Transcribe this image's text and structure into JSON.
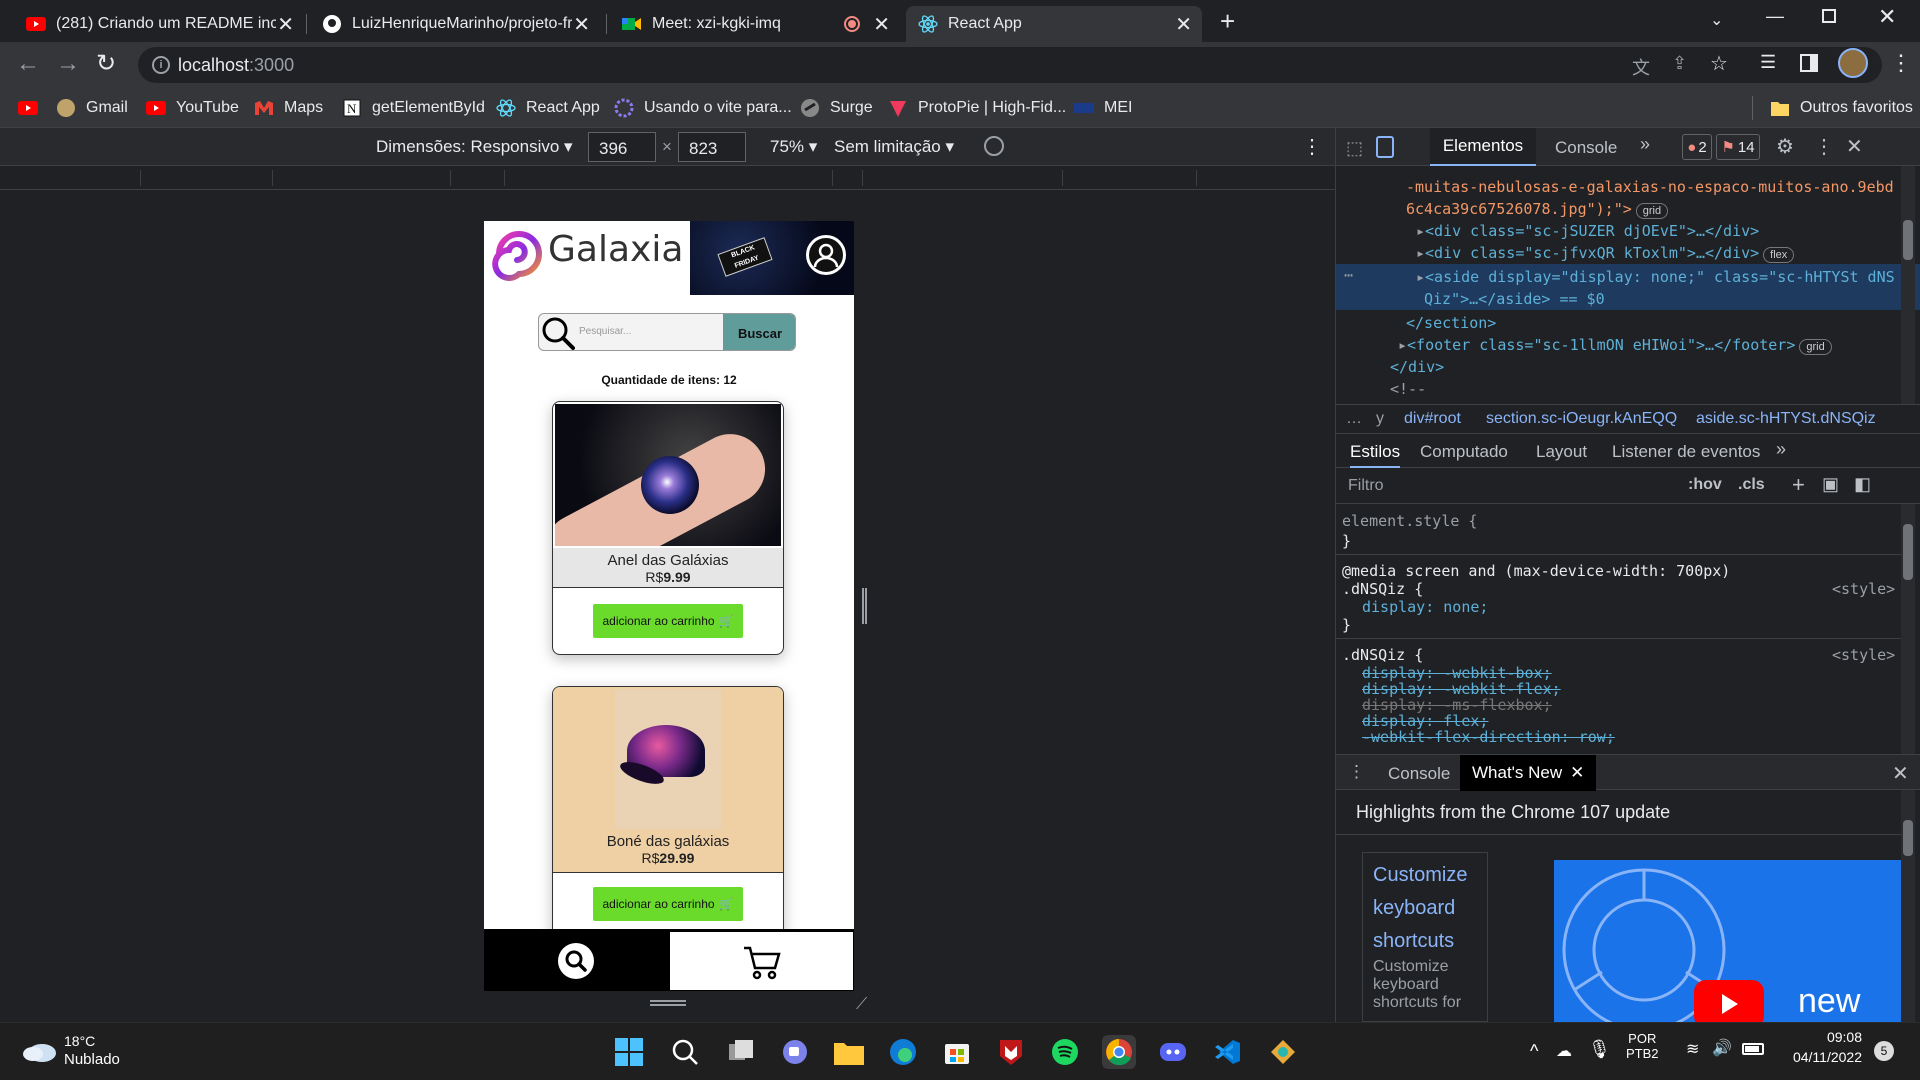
{
  "browser": {
    "tabs": [
      {
        "title": "(281) Criando um README incrív",
        "icon": "youtube-icon",
        "active": false
      },
      {
        "title": "LuizHenriqueMarinho/projeto-fro",
        "icon": "github-icon",
        "active": false
      },
      {
        "title": "Meet: xzi-kgki-imq",
        "icon": "meet-icon",
        "active": false
      },
      {
        "title": "React App",
        "icon": "react-icon",
        "active": true
      }
    ],
    "new_tab": "+",
    "url_host": "localhost",
    "url_port": ":3000",
    "bookmarks": [
      {
        "label": "",
        "icon": "youtube-icon"
      },
      {
        "label": "Gmail",
        "icon": "gmail-icon"
      },
      {
        "label": "YouTube",
        "icon": "youtube-icon"
      },
      {
        "label": "Maps",
        "icon": "maps-icon"
      },
      {
        "label": "getElementById",
        "icon": "notion-icon"
      },
      {
        "label": "React App",
        "icon": "react-icon"
      },
      {
        "label": "Usando o vite para...",
        "icon": "vite-icon"
      },
      {
        "label": "Surge",
        "icon": "surge-icon"
      },
      {
        "label": "ProtoPie | High-Fid...",
        "icon": "protopie-icon"
      },
      {
        "label": "MEI",
        "icon": "mei-icon"
      }
    ],
    "other_favorites": "Outros favoritos"
  },
  "device_toolbar": {
    "dimensions_label": "Dimensões: Responsivo",
    "width": "396",
    "times": "×",
    "height": "823",
    "zoom": "75%",
    "throttle": "Sem limitação"
  },
  "app": {
    "brand": "Galaxia",
    "banner_text": "BLACK FRIDAY",
    "search_placeholder": "Pesquisar...",
    "search_button": "Buscar",
    "quantity_label": "Quantidade de itens: 12",
    "products": [
      {
        "name": "Anel das Galáxias",
        "currency": "R$",
        "price": "9.99",
        "button": "adicionar ao carrinho"
      },
      {
        "name": "Boné das galáxias",
        "currency": "R$",
        "price": "29.99",
        "button": "adicionar ao carrinho"
      }
    ]
  },
  "devtools": {
    "tabs": [
      "Elementos",
      "Console"
    ],
    "error_count": "2",
    "warning_count": "14",
    "dom_lines": [
      {
        "text": "-muitas-nebulosas-e-galaxias-no-espaco-muitos-ano.9ebd"
      },
      {
        "text": "6c4ca39c67526078.jpg\");\">"
      },
      {
        "text": "<div class=\"sc-jSUZER djOEvE\">…</div>"
      },
      {
        "text": "<div class=\"sc-jfvxQR kToxlm\">…</div>"
      },
      {
        "text": "<aside display=\"display: none;\" class=\"sc-hHTYSt dNS"
      },
      {
        "text": "Qiz\">…</aside> == $0"
      },
      {
        "text": "</section>"
      },
      {
        "text": "<footer class=\"sc-1llmON eHIWoi\">…</footer>"
      },
      {
        "text": "</div>"
      },
      {
        "text": "<!--"
      }
    ],
    "pills": [
      "grid",
      "flex",
      "grid"
    ],
    "breadcrumb": [
      "…",
      "y",
      "div#root",
      "section.sc-iOeugr.kAnEQQ",
      "aside.sc-hHTYSt.dNSQiz"
    ],
    "styles_tabs": [
      "Estilos",
      "Computado",
      "Layout",
      "Listener de eventos"
    ],
    "filter_placeholder": "Filtro",
    "hov": ":hov",
    "cls": ".cls",
    "css_lines": [
      "element.style {",
      "}",
      "@media screen and (max-device-width: 700px)",
      ".dNSQiz {",
      "display: none;",
      "}",
      ".dNSQiz {",
      "display: -webkit-box;",
      "display: -webkit-flex;",
      "display: -ms-flexbox;",
      "display: flex;",
      "-webkit-flex-direction: row;"
    ],
    "style_source": "<style>",
    "drawer_tabs": [
      "Console",
      "What's New"
    ],
    "whats_new_heading": "Highlights from the Chrome 107 update",
    "whats_new_link": "Customize keyboard shortcuts",
    "whats_new_desc": "Customize keyboard shortcuts for",
    "video_text": "new"
  },
  "taskbar": {
    "weather_temp": "18°C",
    "weather_desc": "Nublado",
    "lang": "POR",
    "layout": "PTB2",
    "time": "09:08",
    "date": "04/11/2022",
    "notif_count": "5"
  },
  "colors": {
    "brand_green": "#6bdb2b",
    "search_button": "#5f9c9a",
    "devtools_selection": "#1e3a5f"
  }
}
